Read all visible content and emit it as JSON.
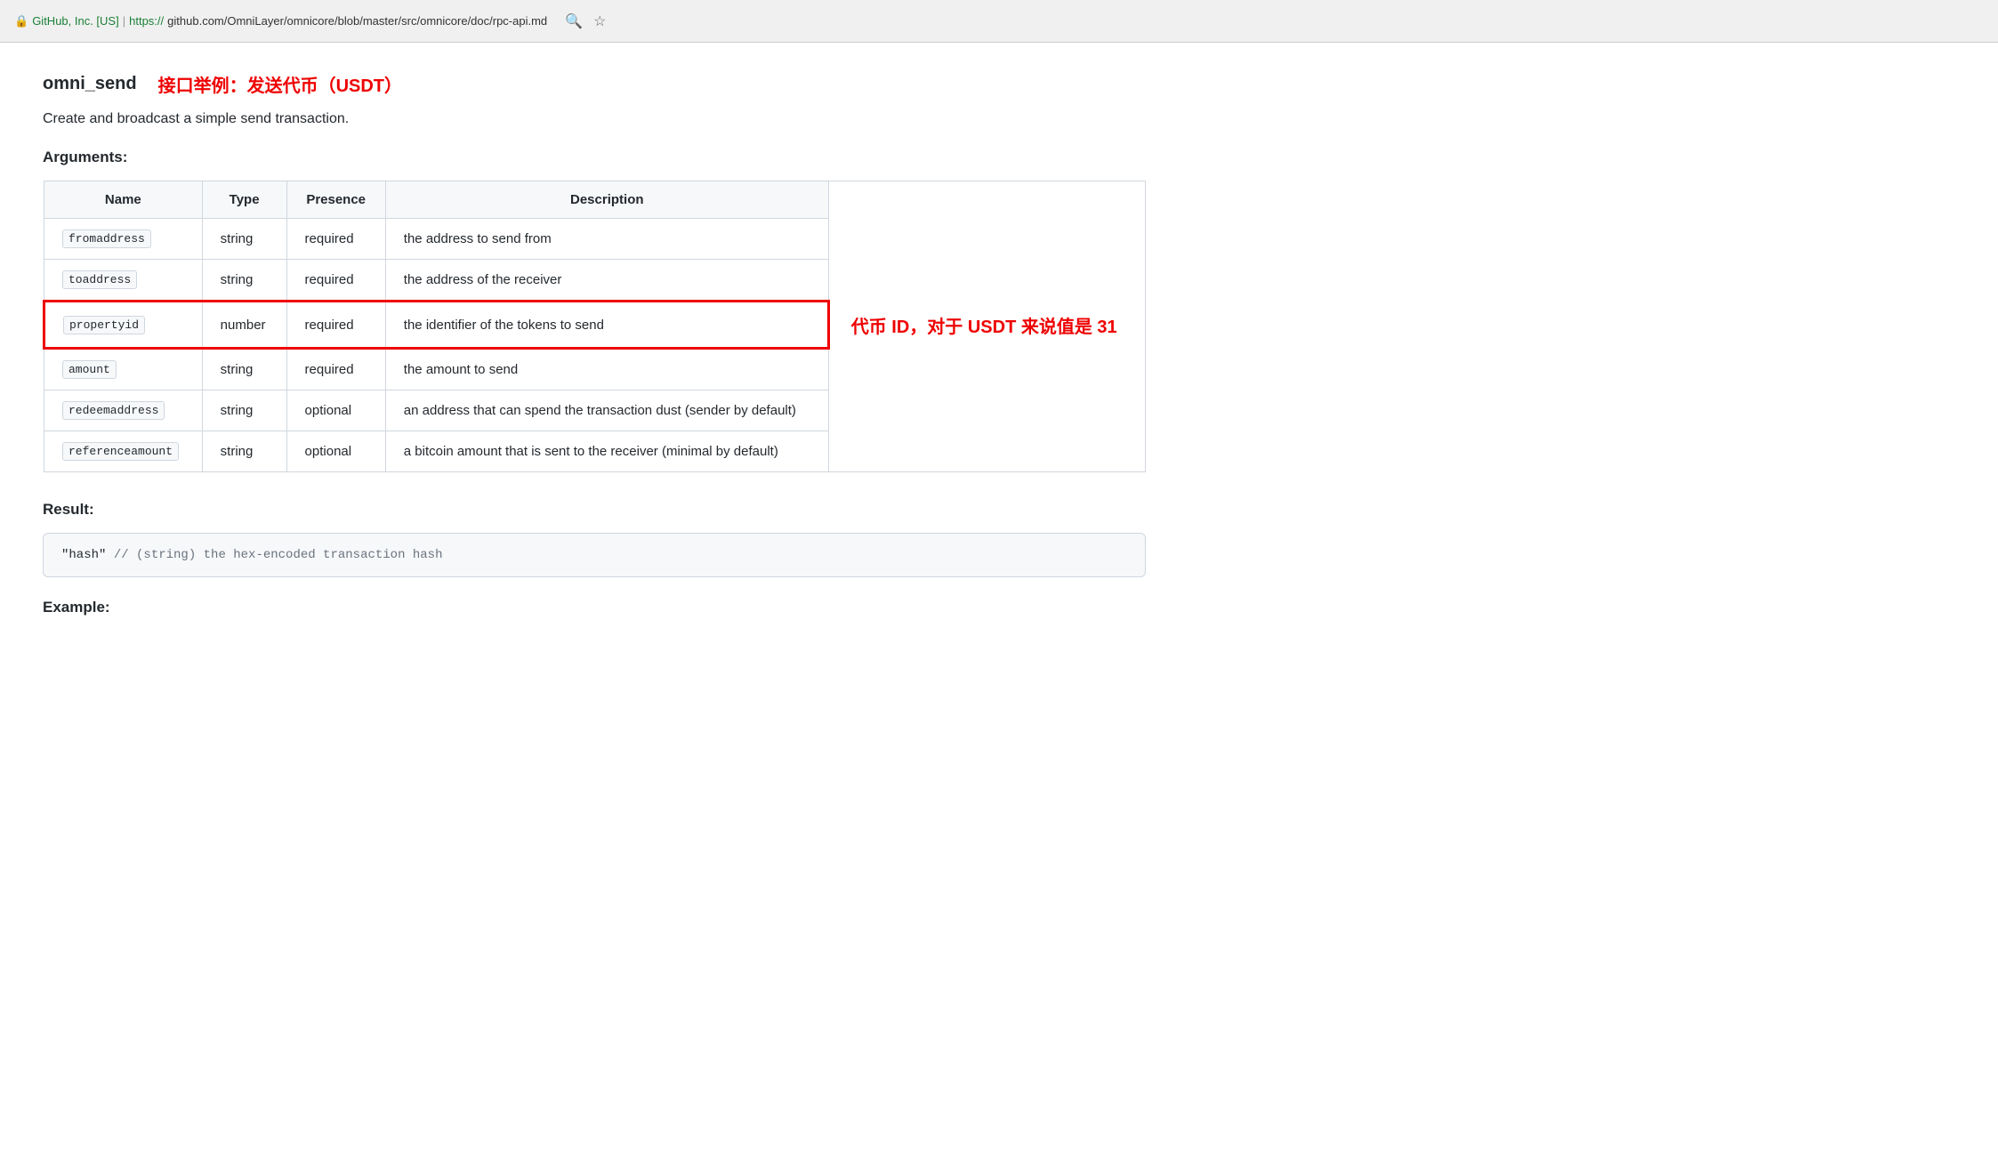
{
  "browser": {
    "security_text": "GitHub, Inc. [US]",
    "url_prefix": "https://",
    "url_domain": "github.com",
    "url_path": "/OmniLayer/omnicore/blob/master/src/omnicore/doc/rpc-api.md",
    "lock_icon": "🔒"
  },
  "page": {
    "title": "omni_send",
    "chinese_subtitle": "接口举例：发送代币（USDT）",
    "description": "Create and broadcast a simple send transaction.",
    "arguments_label": "Arguments:",
    "result_label": "Result:",
    "example_label": "Example:",
    "table": {
      "headers": [
        "Name",
        "Type",
        "Presence",
        "Description"
      ],
      "rows": [
        {
          "name": "fromaddress",
          "type": "string",
          "presence": "required",
          "description": "the address to send from",
          "highlighted": false
        },
        {
          "name": "toaddress",
          "type": "string",
          "presence": "required",
          "description": "the address of the receiver",
          "highlighted": false
        },
        {
          "name": "propertyid",
          "type": "number",
          "presence": "required",
          "description": "the identifier of the tokens to send",
          "highlighted": true,
          "annotation": "代币 ID，对于 USDT 来说值是 31"
        },
        {
          "name": "amount",
          "type": "string",
          "presence": "required",
          "description": "the amount to send",
          "highlighted": false
        },
        {
          "name": "redeemaddress",
          "type": "string",
          "presence": "optional",
          "description": "an address that can spend the transaction dust (sender by default)",
          "highlighted": false
        },
        {
          "name": "referenceamount",
          "type": "string",
          "presence": "optional",
          "description": "a bitcoin amount that is sent to the receiver (minimal by default)",
          "highlighted": false
        }
      ]
    },
    "result_code": "\"hash\"  // (string) the hex-encoded transaction hash",
    "result_code_string": "\"hash\"",
    "result_code_comment": "  // (string) the hex-encoded transaction hash"
  }
}
